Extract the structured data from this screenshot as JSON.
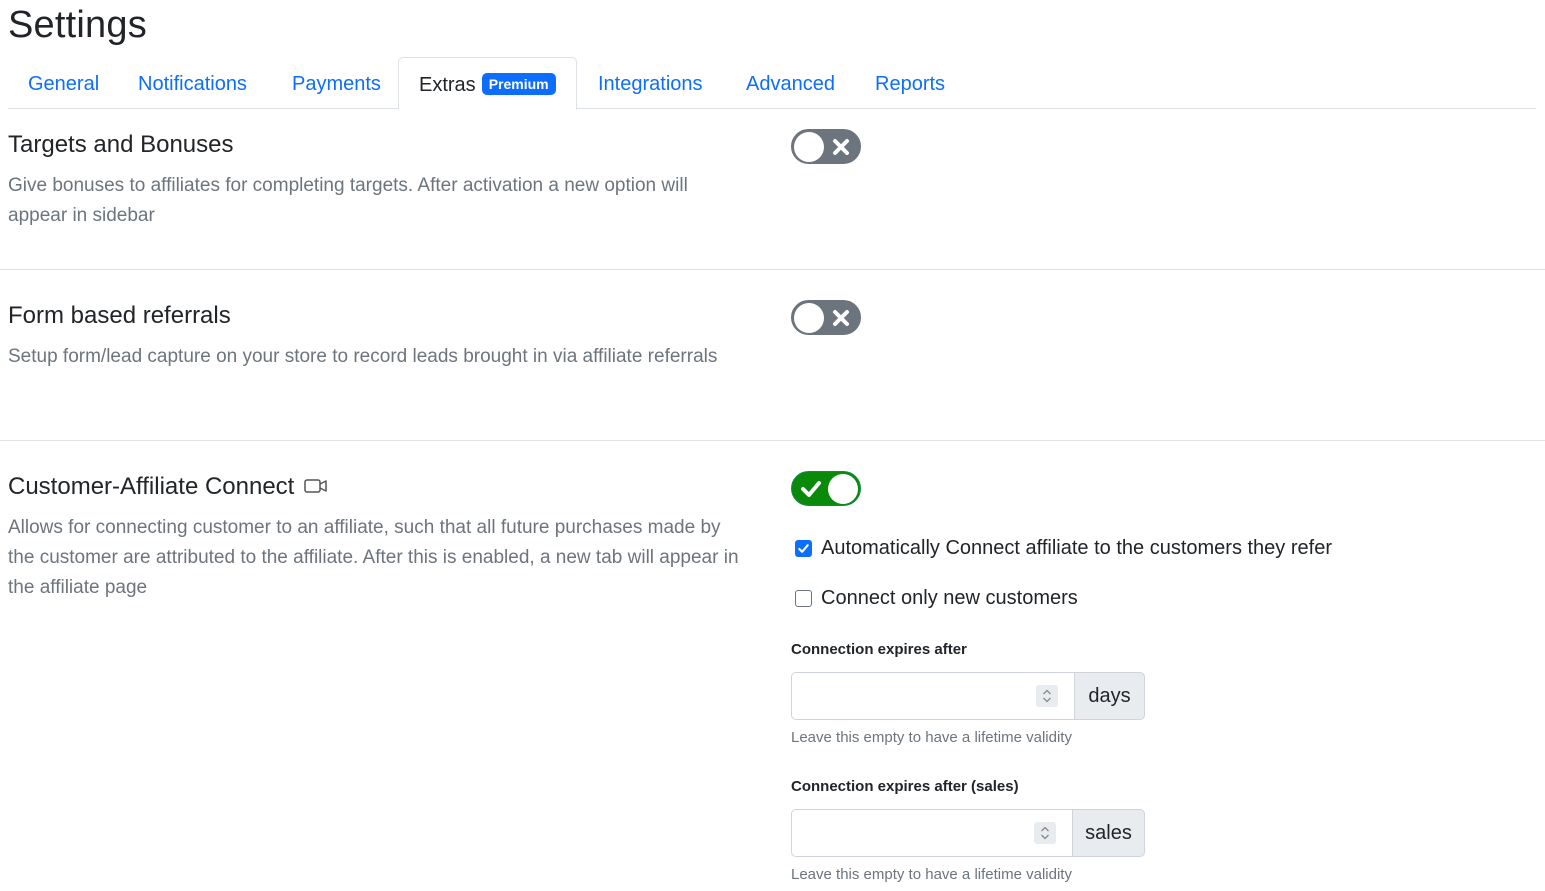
{
  "page": {
    "title": "Settings"
  },
  "tabs": [
    {
      "label": "General"
    },
    {
      "label": "Notifications"
    },
    {
      "label": "Payments"
    },
    {
      "label": "Extras",
      "badge": "Premium",
      "active": true
    },
    {
      "label": "Integrations"
    },
    {
      "label": "Advanced"
    },
    {
      "label": "Reports"
    }
  ],
  "sections": [
    {
      "title": "Targets and Bonuses",
      "description": "Give bonuses to affiliates for completing targets. After activation a new option will appear in sidebar",
      "enabled": false
    },
    {
      "title": "Form based referrals",
      "description": "Setup form/lead capture on your store to record leads brought in via affiliate referrals",
      "enabled": false
    },
    {
      "title": "Customer-Affiliate Connect",
      "title_icon": "video-icon",
      "description": "Allows for connecting customer to an affiliate, such that all future purchases made by the customer are attributed to the affiliate. After this is enabled, a new tab will appear in the affiliate page",
      "enabled": true,
      "options": {
        "auto_connect": {
          "label": "Automatically Connect affiliate to the customers they refer",
          "checked": true
        },
        "new_only": {
          "label": "Connect only new customers",
          "checked": false
        },
        "expires_days": {
          "label": "Connection expires after",
          "value": "",
          "unit": "days",
          "help": "Leave this empty to have a lifetime validity"
        },
        "expires_sales": {
          "label": "Connection expires after (sales)",
          "value": "",
          "unit": "sales",
          "help": "Leave this empty to have a lifetime validity"
        }
      }
    }
  ],
  "colors": {
    "link": "#0d6efd",
    "toggle_off": "#6c757d",
    "toggle_on": "#0a8a0a",
    "badge": "#0d6efd"
  }
}
